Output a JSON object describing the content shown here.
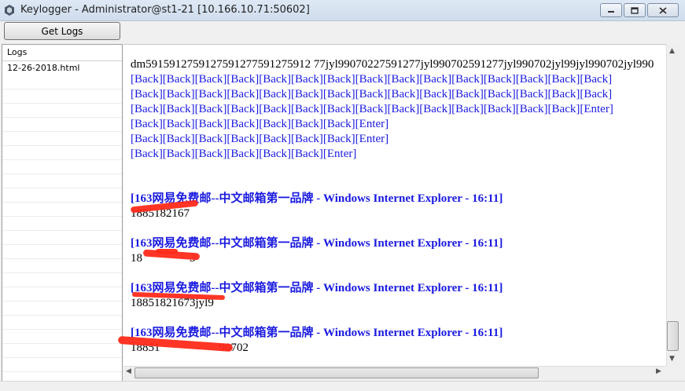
{
  "window": {
    "title": "Keylogger - Administrator@st1-21 [10.166.10.71:50602]",
    "controls": [
      "minimize-icon",
      "maximize-icon",
      "close-icon"
    ]
  },
  "toolbar": {
    "get_logs_label": "Get Logs"
  },
  "logs_panel": {
    "header": "Logs",
    "items": [
      {
        "label": "12-26-2018.html"
      }
    ]
  },
  "content": {
    "top_line": "dm5915912759127591277591275912 77jyl99070227591277jyl990702591277jyl990702jyl99jyl990702jyl990",
    "back_lines": [
      "[Back][Back][Back][Back][Back][Back][Back][Back][Back][Back][Back][Back][Back][Back][Back]",
      "[Back][Back][Back][Back][Back][Back][Back][Back][Back][Back][Back][Back][Back][Back][Back]",
      "[Back][Back][Back][Back][Back][Back][Back][Back][Back][Back][Back][Back][Back][Back][Enter]",
      "[Back][Back][Back][Back][Back][Back][Back][Enter]",
      "[Back][Back][Back][Back][Back][Back][Back][Enter]",
      "[Back][Back][Back][Back][Back][Back][Enter]"
    ],
    "entries": [
      {
        "title": "[163网易免费邮--中文邮箱第一品牌  - Windows Internet Explorer - 16:11]",
        "text": "1885182167"
      },
      {
        "title": "[163网易免费邮--中文邮箱第一品牌  - Windows Internet Explorer - 16:11]",
        "text": "18                3"
      },
      {
        "title": "[163网易免费邮--中文邮箱第一品牌  - Windows Internet Explorer - 16:11]",
        "text": "18851821673jyl9"
      },
      {
        "title": "[163网易免费邮--中文邮箱第一品牌  - Windows Internet Explorer - 16:11]",
        "text": "18851                    90702"
      }
    ]
  },
  "colors": {
    "link_blue": "#1a1ae0",
    "redaction_red": "#ff2a1a"
  }
}
